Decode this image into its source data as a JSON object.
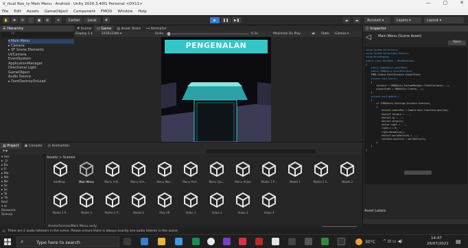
{
  "window": {
    "title": "V_rtual Roo_ty  Main Menu · Android · Unity 2020.3.40f1 Personal <DX11>",
    "minimize": "—",
    "maximize": "▢",
    "close": "✕"
  },
  "menu": [
    "File",
    "Edit",
    "Assets",
    "GameObject",
    "Component",
    "FMOD",
    "Window",
    "Help"
  ],
  "toolbar": {
    "pivot": "Center",
    "space": "Local",
    "account": "Account",
    "layers": "Layers",
    "layout": "Layout"
  },
  "hierarchy": {
    "tab": "Hierarchy",
    "search_placeholder": "All",
    "items": [
      "▾ Main Menu",
      "  ▸ Camera",
      "  ▸ SF Scene Elements",
      "    UI/Camera",
      "    EventSystem",
      "    ApplicationManager",
      "    Directional Light",
      "    GameObject",
      "    Audio Source",
      "▸ DontDestroyOnLoad"
    ]
  },
  "viewtabs": {
    "scene": "Scene",
    "game": "Game",
    "asset_store": "Asset Store",
    "animator": "Animator",
    "display": "Display 1",
    "resolution": "2400x1080",
    "scale_label": "Scale",
    "scale_value": "0.3x",
    "maximize": "Maximize On Play",
    "stats": "Stats",
    "gizmos": "Gizmos"
  },
  "game": {
    "banner_text": "PENGENALAN"
  },
  "inspector": {
    "tab": "Inspector",
    "title": "Main Menu (Scene Asset)",
    "open_button": "Open",
    "code_lines": [
      "using System.Collections;",
      "using System.Collections.Generic;",
      "using UnityEngine;",
      "",
      "public class MainMenu : MonoBehaviour",
      "{",
      "    public GameObject panelMenu;",
      "",
      "    public FMODUnity.EventReference;",
      "    FMOD.Studio.EventInstance playerState;",
      "",
      "    private void Start()",
      "    {",
      "        instance = FMODUnity.RuntimeManager.CreateInstance(...);",
      "        playerState = FMODUnity.Create(...);",
      "    }",
      "",
      "    private void Update()",
      "    {",
      "        if (FMODUnity.Settings.Instance.IsActive)",
      "        {",
      "            Vector3 cameraPos = Camera.main.transform.position;",
      "            Vector3 forward = ...;",
      "            Vector3 up = ...;",
      "            Vector3 velocity;",
      "            vector.right = ...;",
      "            right.x = 0;",
      "            right.Normalize();",
      "            Vector3 worldVelocity = ...;",
      "",
      "            instance.position = worldVelocity;",
      "        }",
      "    }",
      "}"
    ],
    "asset_labels": "Asset Labels"
  },
  "project": {
    "tab_project": "Project",
    "tab_console": "Console",
    "tab_animation": "Animation",
    "breadcrumb": "Assets > Scenes",
    "footer_path": "Assets/Scenes/Main Menu.unity",
    "folders": [
      "▾ Ass",
      "  ▸ _U",
      "  ▸ Ba",
      "  ▸ Fl",
      "  ▸ Ma",
      "  ▸ Mo",
      "  ▸ No",
      "  ▸ Sc",
      "  ▸ Sc",
      "  ▸ Te",
      "  ▸ Th",
      "    Resl",
      "  ▾ sc",
      "  Resource",
      "  Scenes"
    ],
    "assets_row1": [
      "AddMod...",
      "Main Menu",
      "Menu 4 M...",
      "Menu Vict...",
      "Menu Mar...",
      "Menu Prof...",
      "Menu Qui...",
      "Menu Video",
      "Model 1 P...",
      "Model 1",
      "Model 2 P...",
      "Model 2"
    ],
    "assets_row2": [
      "Model 3 P...",
      "Model 3",
      "Model 4 P...",
      "Model 4",
      "Play AR",
      "Video 1",
      "Video 2",
      "Video 3",
      "Video 4"
    ]
  },
  "status": {
    "message": "There are 2 audio listeners in the scene. Please ensure there is always exactly one audio listener in the scene."
  },
  "taskbar": {
    "search_placeholder": "Type here to search",
    "temperature": "30°C",
    "time": "14:47",
    "date": "26/07/2021"
  },
  "icons": [
    "search-icon",
    "play-icon",
    "pause-icon",
    "step-icon",
    "unity-scene-icon",
    "windows-icon",
    "warning-icon"
  ],
  "colors": {
    "accent_blue": "#3a79c7",
    "teal": "#2bb3b8",
    "editor_bg": "#262626"
  }
}
